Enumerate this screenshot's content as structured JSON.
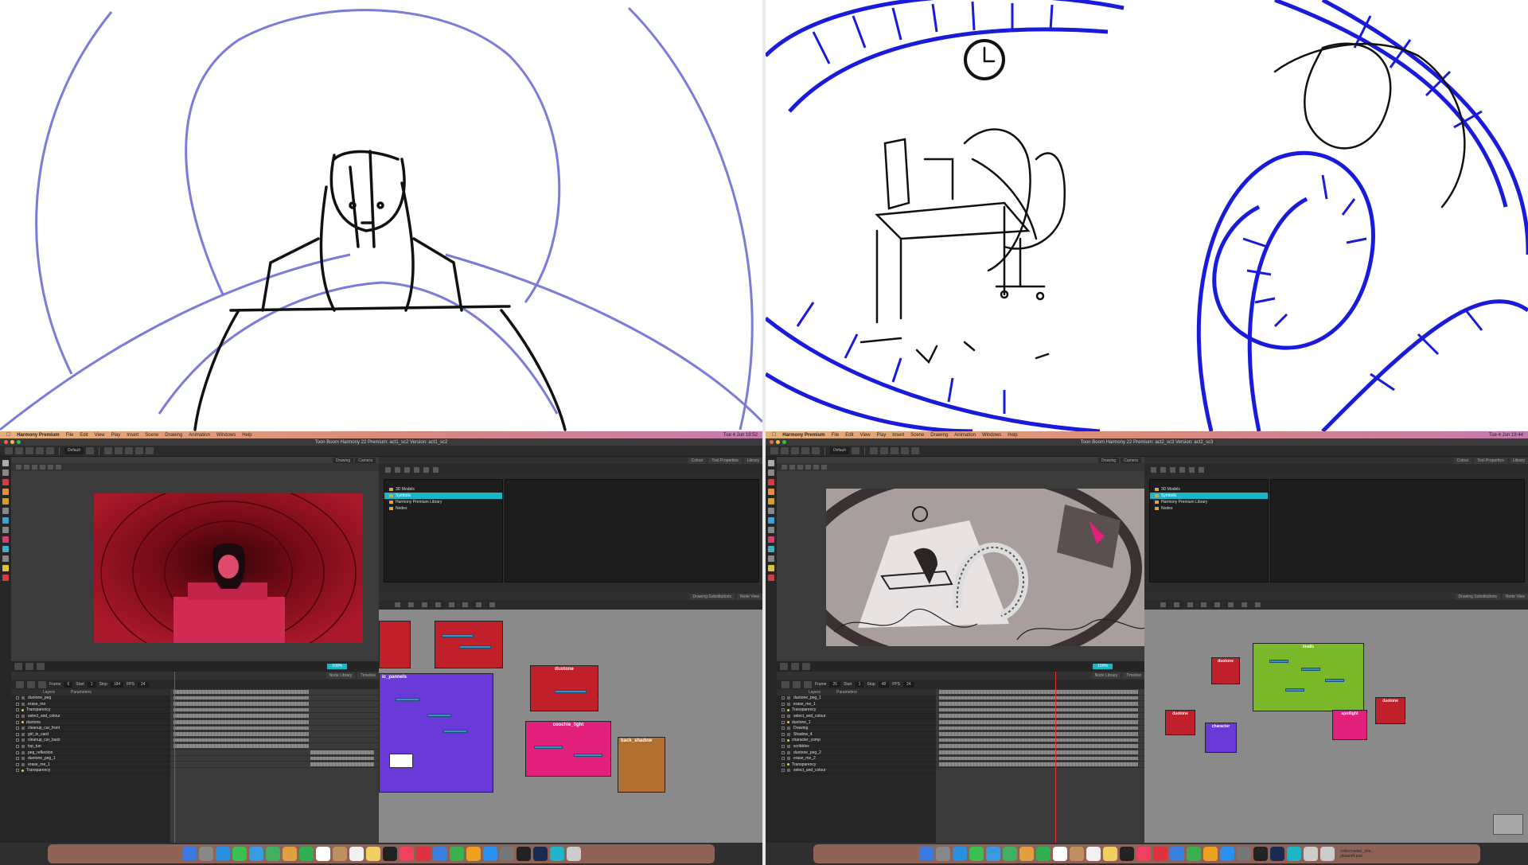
{
  "left_app": {
    "menubar": {
      "app_name": "Harmony Premium",
      "menus": [
        "File",
        "Edit",
        "View",
        "Play",
        "Insert",
        "Scene",
        "Drawing",
        "Animation",
        "Windows",
        "Help"
      ],
      "clock": "Tue 4 Jun 19:52"
    },
    "title": "Toon Boom Harmony 22 Premium: act1_sc2 Version: act1_sc2",
    "toolbar_default": "Default",
    "viewer_tabs": [
      "Drawing",
      "Camera"
    ],
    "viewer_zoom": "100%",
    "timeline_tabs": [
      "Node Library",
      "Timeline"
    ],
    "timeline_fields": {
      "frame_label": "Frame",
      "frame": "6",
      "start_label": "Start",
      "start": "1",
      "stop_label": "Stop",
      "stop": "184",
      "fps_label": "FPS",
      "fps": "24"
    },
    "layer_header": {
      "layers": "Layers",
      "parameters": "Parameters"
    },
    "layers": [
      "duotone_peg",
      "erase_me",
      "Transparency",
      "select_and_colour",
      "duotone",
      "cleanup_car_front",
      "girl_in_card",
      "cleanup_car_back",
      "top_tun",
      "peg_reflection",
      "duotone_peg_1",
      "erase_me_1",
      "Transparency"
    ],
    "panel_tabs": [
      "Colour",
      "Tool Properties",
      "Library"
    ],
    "library_items": [
      "3D Models",
      "Symbols",
      "Harmony Premium Library",
      "Nodes"
    ],
    "library_selected": "Symbols",
    "node_tabs": [
      "Drawing Substitutions",
      "Node View"
    ],
    "node_groups": [
      "ic_pannels",
      "duotone",
      "coochie_light",
      "back_shadow"
    ]
  },
  "right_app": {
    "menubar": {
      "app_name": "Harmony Premium",
      "menus": [
        "File",
        "Edit",
        "View",
        "Play",
        "Insert",
        "Scene",
        "Drawing",
        "Animation",
        "Windows",
        "Help"
      ],
      "clock": "Tue 4 Jun 19:44"
    },
    "title": "Toon Boom Harmony 22 Premium: act2_sc3 Version: act2_sc3",
    "toolbar_default": "Default",
    "viewer_tabs": [
      "Drawing",
      "Camera"
    ],
    "viewer_zoom": "100%",
    "timeline_tabs": [
      "Node Library",
      "Timeline"
    ],
    "timeline_fields": {
      "frame_label": "Frame",
      "frame": "26",
      "start_label": "Start",
      "start": "1",
      "stop_label": "Stop",
      "stop": "48",
      "fps_label": "FPS",
      "fps": "24"
    },
    "layer_header": {
      "layers": "Layers",
      "parameters": "Parameters"
    },
    "layers": [
      "duotone_peg_1",
      "erase_me_1",
      "Transparency",
      "select_and_colour",
      "duotone_1",
      "Drawing",
      "Shadow_4",
      "character_comp",
      "scribbles",
      "duotone_peg_2",
      "erase_me_2",
      "Transparency",
      "select_and_colour"
    ],
    "panel_tabs": [
      "Colour",
      "Tool Properties",
      "Library"
    ],
    "library_items": [
      "3D Models",
      "Symbols",
      "Harmony Premium Library",
      "Nodes"
    ],
    "library_selected": "Symbols",
    "node_tabs": [
      "Drawing Substitutions",
      "Node View"
    ],
    "node_groups": [
      "duotone",
      "duotone",
      "character",
      "tmails",
      "spotlight",
      "duotone"
    ],
    "dock_file_label": "rollercoaster_sho...",
    "dock_file_sub": "pbvard4.psd"
  },
  "colors": {
    "sketch_blue_soft": "#7b7bd8",
    "sketch_blue_bold": "#1a1adb",
    "selection_cyan": "#1fb5c9",
    "render_red": "#8a1020",
    "render_pink": "#d02a55",
    "node_purple": "#6a3ad8",
    "node_magenta": "#e0207a",
    "node_green": "#7ab82a",
    "node_red": "#c0202a"
  }
}
